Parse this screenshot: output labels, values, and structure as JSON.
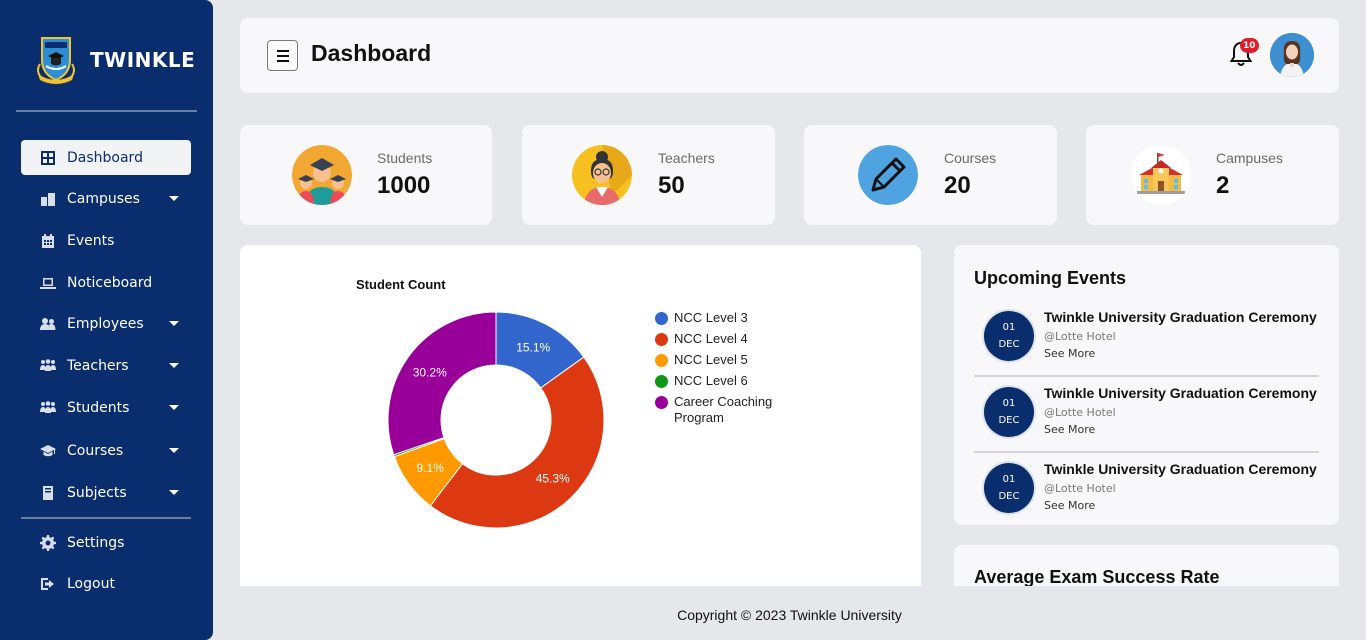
{
  "brand": {
    "name": "TWINKLE"
  },
  "sidebar": {
    "items": [
      {
        "label": "Dashboard",
        "icon": "grid-icon",
        "active": true,
        "has_submenu": false
      },
      {
        "label": "Campuses",
        "icon": "buildings-icon",
        "has_submenu": true
      },
      {
        "label": "Events",
        "icon": "calendar-icon",
        "has_submenu": false
      },
      {
        "label": "Noticeboard",
        "icon": "laptop-icon",
        "has_submenu": false
      },
      {
        "label": "Employees",
        "icon": "users-icon",
        "has_submenu": true
      },
      {
        "label": "Teachers",
        "icon": "group-icon",
        "has_submenu": true
      },
      {
        "label": "Students",
        "icon": "group-icon",
        "has_submenu": true
      },
      {
        "label": "Courses",
        "icon": "graduation-cap-icon",
        "has_submenu": true
      },
      {
        "label": "Subjects",
        "icon": "book-icon",
        "has_submenu": true
      }
    ],
    "bottom_items": [
      {
        "label": "Settings",
        "icon": "gear-icon"
      },
      {
        "label": "Logout",
        "icon": "logout-icon"
      }
    ]
  },
  "header": {
    "title": "Dashboard",
    "notification_count": "10"
  },
  "stats": [
    {
      "label": "Students",
      "value": "1000",
      "icon": "students-icon"
    },
    {
      "label": "Teachers",
      "value": "50",
      "icon": "teacher-icon"
    },
    {
      "label": "Courses",
      "value": "20",
      "icon": "pencil-icon"
    },
    {
      "label": "Campuses",
      "value": "2",
      "icon": "school-building-icon"
    }
  ],
  "chart_data": {
    "type": "pie",
    "title": "Student Count",
    "donut": true,
    "legend_position": "right",
    "categories": [
      "NCC Level 3",
      "NCC Level 4",
      "NCC Level 5",
      "NCC Level 6",
      "Career Coaching Program"
    ],
    "values": [
      15.1,
      45.3,
      9.1,
      0.3,
      30.2
    ],
    "labels": [
      "15.1%",
      "45.3%",
      "9.1%",
      "",
      "30.2%"
    ],
    "colors": [
      "#3366cc",
      "#dc3912",
      "#ff9900",
      "#109618",
      "#990099"
    ]
  },
  "events": {
    "title": "Upcoming Events",
    "items": [
      {
        "day": "01",
        "month": "DEC",
        "title": "Twinkle University Graduation Ceremony",
        "place": "@Lotte Hotel",
        "link": "See More"
      },
      {
        "day": "01",
        "month": "DEC",
        "title": "Twinkle University Graduation Ceremony",
        "place": "@Lotte Hotel",
        "link": "See More"
      },
      {
        "day": "01",
        "month": "DEC",
        "title": "Twinkle University Graduation Ceremony",
        "place": "@Lotte Hotel",
        "link": "See More"
      }
    ]
  },
  "exam": {
    "title": "Average Exam Success Rate"
  },
  "footer": {
    "text": "Copyright © 2023 Twinkle University"
  }
}
